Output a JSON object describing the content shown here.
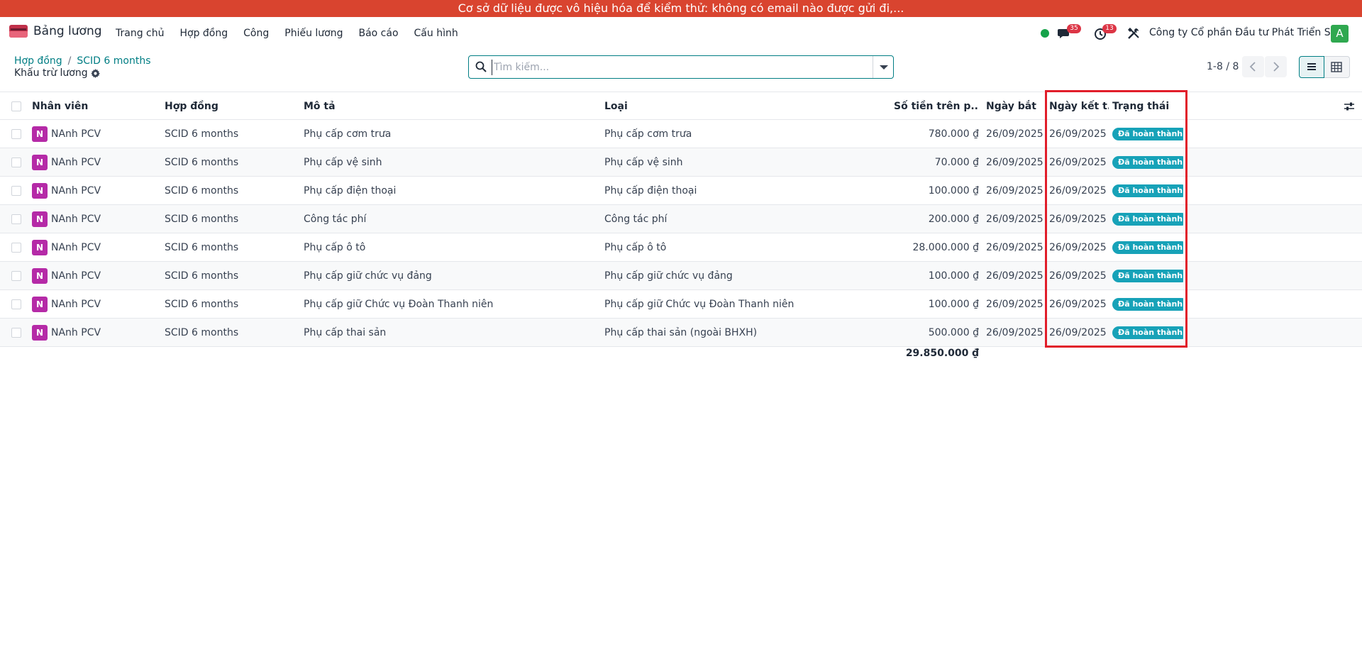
{
  "banner": {
    "text": "Cơ sở dữ liệu được vô hiệu hóa để kiểm thử: không có email nào được gửi đi,..."
  },
  "app": {
    "name": "Bảng lương"
  },
  "menu": [
    "Trang chủ",
    "Hợp đồng",
    "Công",
    "Phiếu lương",
    "Báo cáo",
    "Cấu hình"
  ],
  "systray": {
    "messages_count": "35",
    "activities_count": "13",
    "company": "Công ty Cổ phần Đầu tư Phát Triển S...",
    "user_initial": "A",
    "status_color": "#16a34a"
  },
  "breadcrumb": {
    "parent": "Hợp đồng",
    "current": "SCID 6 months"
  },
  "subtitle": "Khấu trừ lương",
  "search": {
    "placeholder": "Tìm kiếm..."
  },
  "pager": {
    "text": "1-8 / 8"
  },
  "columns": {
    "employee": "Nhân viên",
    "contract": "Hợp đồng",
    "description": "Mô tả",
    "type": "Loại",
    "amount": "Số tiền trên p...",
    "start": "Ngày bắt ...",
    "end": "Ngày kết t...",
    "status": "Trạng thái"
  },
  "rows": [
    {
      "employee_initial": "N",
      "employee": "NAnh PCV",
      "contract": "SCID 6 months",
      "description": "Phụ cấp cơm trưa",
      "type": "Phụ cấp cơm trưa",
      "amount": "780.000 ₫",
      "start": "26/09/2025",
      "end": "26/09/2025",
      "status": "Đã hoàn thành"
    },
    {
      "employee_initial": "N",
      "employee": "NAnh PCV",
      "contract": "SCID 6 months",
      "description": "Phụ cấp vệ sinh",
      "type": "Phụ cấp vệ sinh",
      "amount": "70.000 ₫",
      "start": "26/09/2025",
      "end": "26/09/2025",
      "status": "Đã hoàn thành"
    },
    {
      "employee_initial": "N",
      "employee": "NAnh PCV",
      "contract": "SCID 6 months",
      "description": "Phụ cấp điện thoại",
      "type": "Phụ cấp điện thoại",
      "amount": "100.000 ₫",
      "start": "26/09/2025",
      "end": "26/09/2025",
      "status": "Đã hoàn thành"
    },
    {
      "employee_initial": "N",
      "employee": "NAnh PCV",
      "contract": "SCID 6 months",
      "description": "Công tác phí",
      "type": "Công tác phí",
      "amount": "200.000 ₫",
      "start": "26/09/2025",
      "end": "26/09/2025",
      "status": "Đã hoàn thành"
    },
    {
      "employee_initial": "N",
      "employee": "NAnh PCV",
      "contract": "SCID 6 months",
      "description": "Phụ cấp ô tô",
      "type": "Phụ cấp ô tô",
      "amount": "28.000.000 ₫",
      "start": "26/09/2025",
      "end": "26/09/2025",
      "status": "Đã hoàn thành"
    },
    {
      "employee_initial": "N",
      "employee": "NAnh PCV",
      "contract": "SCID 6 months",
      "description": "Phụ cấp giữ chức vụ đảng",
      "type": "Phụ cấp giữ chức vụ đảng",
      "amount": "100.000 ₫",
      "start": "26/09/2025",
      "end": "26/09/2025",
      "status": "Đã hoàn thành"
    },
    {
      "employee_initial": "N",
      "employee": "NAnh PCV",
      "contract": "SCID 6 months",
      "description": "Phụ cấp giữ Chức vụ Đoàn Thanh niên",
      "type": "Phụ cấp giữ Chức vụ Đoàn Thanh niên",
      "amount": "100.000 ₫",
      "start": "26/09/2025",
      "end": "26/09/2025",
      "status": "Đã hoàn thành"
    },
    {
      "employee_initial": "N",
      "employee": "NAnh PCV",
      "contract": "SCID 6 months",
      "description": "Phụ cấp thai sản",
      "type": "Phụ cấp thai sản (ngoài BHXH)",
      "amount": "500.000 ₫",
      "start": "26/09/2025",
      "end": "26/09/2025",
      "status": "Đã hoàn thành"
    }
  ],
  "total": "29.850.000 ₫",
  "colors": {
    "accent": "#017e84",
    "banner": "#d9442f",
    "status_pill": "#17a2b8",
    "employee_avatar": "#b52aa7",
    "highlight": "#e11d2a"
  }
}
